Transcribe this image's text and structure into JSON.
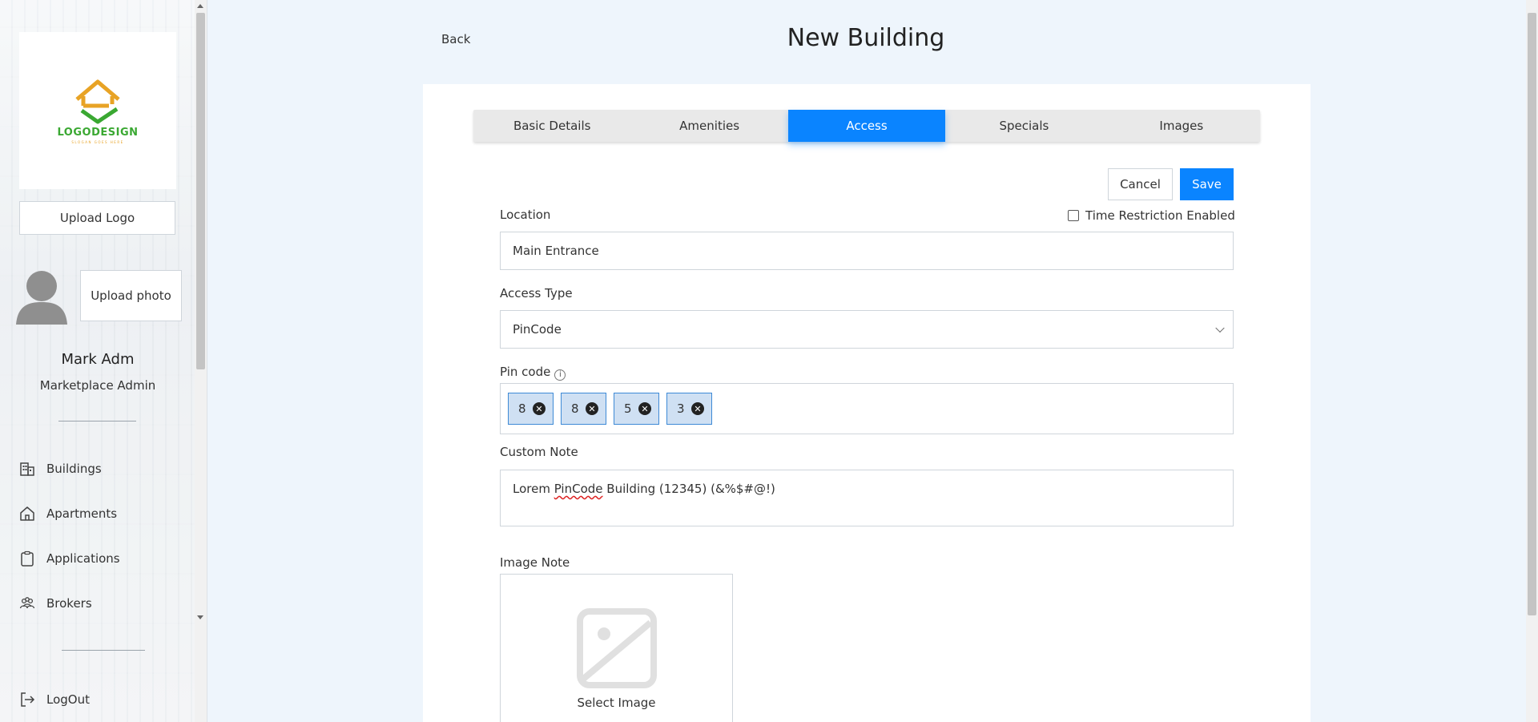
{
  "sidebar": {
    "logo_text": "LOGODESIGN",
    "logo_sub": "SLOGAN GOES HERE",
    "upload_logo_label": "Upload Logo",
    "upload_photo_label": "Upload photo",
    "user_name": "Mark Adm",
    "user_role": "Marketplace Admin",
    "nav_items": [
      {
        "label": "Buildings",
        "icon": "buildings-icon"
      },
      {
        "label": "Apartments",
        "icon": "home-icon"
      },
      {
        "label": "Applications",
        "icon": "clipboard-icon"
      },
      {
        "label": "Brokers",
        "icon": "people-icon"
      }
    ],
    "logout_label": "LogOut"
  },
  "header": {
    "back_label": "Back",
    "title": "New Building"
  },
  "tabs": [
    {
      "label": "Basic Details",
      "active": false
    },
    {
      "label": "Amenities",
      "active": false
    },
    {
      "label": "Access",
      "active": true
    },
    {
      "label": "Specials",
      "active": false
    },
    {
      "label": "Images",
      "active": false
    }
  ],
  "actions": {
    "cancel_label": "Cancel",
    "save_label": "Save"
  },
  "form": {
    "location_label": "Location",
    "location_value": "Main Entrance",
    "time_restriction_label": "Time Restriction Enabled",
    "time_restriction_checked": false,
    "access_type_label": "Access Type",
    "access_type_value": "PinCode",
    "pin_code_label": "Pin code",
    "pin_digits": [
      "8",
      "8",
      "5",
      "3"
    ],
    "custom_note_label": "Custom Note",
    "custom_note_prefix": "Lorem ",
    "custom_note_misspelled": "PinCode",
    "custom_note_suffix": " Building (12345) (&%$#@!)",
    "image_note_label": "Image Note",
    "select_image_label": "Select Image"
  },
  "colors": {
    "accent": "#0a84ff",
    "chip_bg": "#cfe0f3",
    "logo_green": "#3aa832",
    "logo_orange": "#e8a325"
  }
}
